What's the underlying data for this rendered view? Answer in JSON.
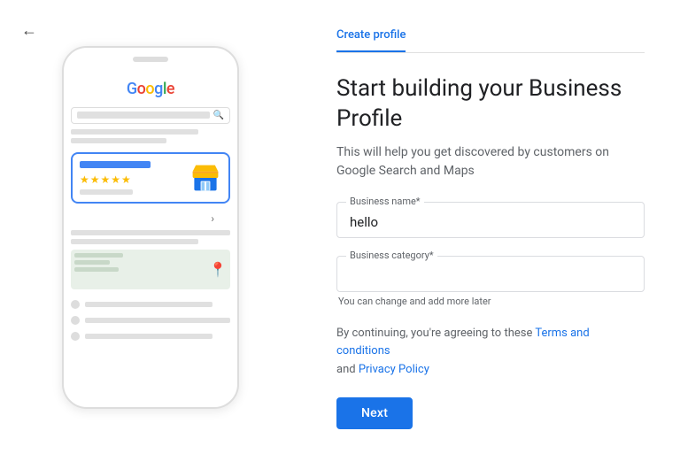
{
  "back_arrow": "←",
  "tab": {
    "label": "Create profile"
  },
  "page": {
    "title": "Start building your Business Profile",
    "subtitle": "This will help you get discovered by customers on\nGoogle Search and Maps"
  },
  "form": {
    "business_name_label": "Business name*",
    "business_name_value": "hello",
    "business_category_label": "Business category*",
    "business_category_placeholder": "",
    "business_category_hint": "You can change and add more later"
  },
  "terms": {
    "prefix": "By continuing, you're agreeing to these ",
    "terms_link": "Terms and conditions",
    "middle": "\nand ",
    "privacy_link": "Privacy Policy"
  },
  "next_button": "Next",
  "phone_mockup": {
    "google_text": "Google",
    "stars": "★★★★★"
  }
}
